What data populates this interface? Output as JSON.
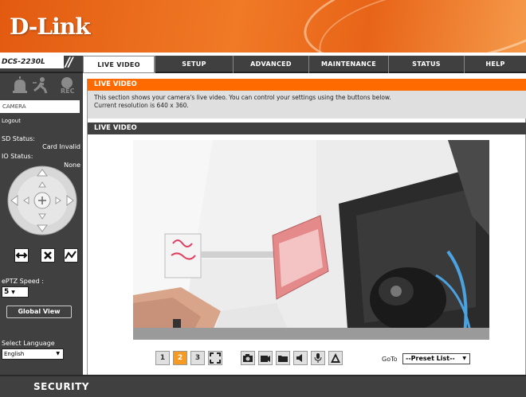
{
  "brand": {
    "logo": "D-Link",
    "model": "DCS-2230L"
  },
  "nav": {
    "tabs": [
      {
        "label": "LIVE VIDEO",
        "active": true
      },
      {
        "label": "SETUP",
        "active": false
      },
      {
        "label": "ADVANCED",
        "active": false
      },
      {
        "label": "MAINTENANCE",
        "active": false
      },
      {
        "label": "STATUS",
        "active": false
      },
      {
        "label": "HELP",
        "active": false
      }
    ]
  },
  "sidebar": {
    "icons": [
      "alarm-icon",
      "motion-icon",
      "rec-icon"
    ],
    "rec_label": "REC",
    "camera_label": "CAMERA",
    "logout_label": "Logout",
    "sd_status_label": "SD Status:",
    "sd_status_value": "Card Invalid",
    "io_status_label": "IO Status:",
    "io_status_value": "None",
    "eptz_speed_label": "ePTZ Speed :",
    "eptz_speed_value": "5",
    "global_view_label": "Global View",
    "select_language_label": "Select Language",
    "language_value": "English"
  },
  "main": {
    "section_title": "LIVE VIDEO",
    "description_line1": "This section shows your camera's live video. You can control your settings using the buttons below.",
    "description_line2": "Current resolution is 640 x 360.",
    "live_video_title": "LIVE VIDEO"
  },
  "toolbar": {
    "buttons": [
      "profile-1",
      "profile-2",
      "profile-3",
      "fullscreen",
      "snapshot",
      "record",
      "folder",
      "speaker",
      "microphone",
      "alert"
    ],
    "profile1_label": "1",
    "profile2_label": "2",
    "profile3_label": "3",
    "goto_label": "GoTo",
    "preset_value": "--Preset List--"
  },
  "footer": {
    "label": "SECURITY"
  },
  "colors": {
    "orange": "#ff6a00",
    "dark": "#404040",
    "desc_bg": "#dfdfdf",
    "active_profile": "#f59a23"
  }
}
